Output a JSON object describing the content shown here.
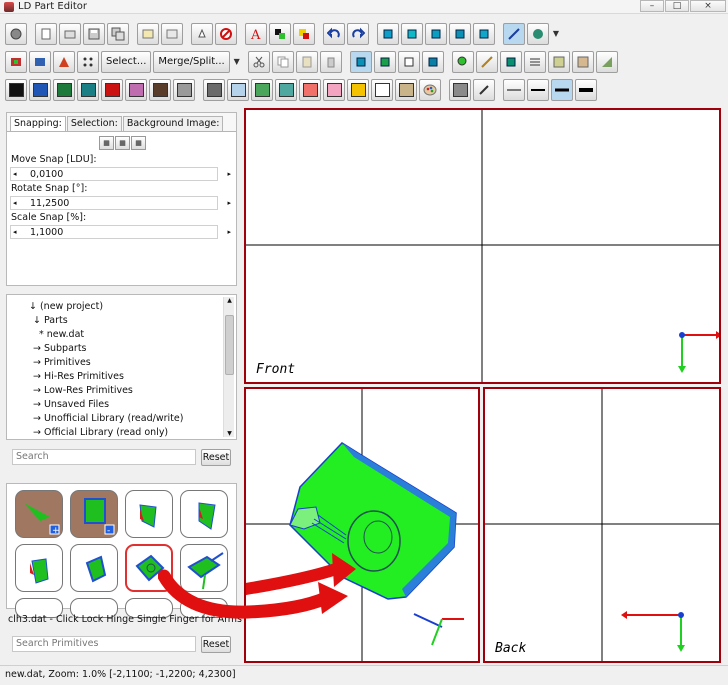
{
  "window": {
    "title": "LD Part Editor",
    "buttons": [
      "–",
      "□",
      "×"
    ]
  },
  "toolbar2": {
    "select_label": "Select...",
    "merge_label": "Merge/Split..."
  },
  "colors": {
    "swatches": [
      "#111111",
      "#1f55b5",
      "#1e7a3a",
      "#1a7f85",
      "#cc1111",
      "#c06db0",
      "#5a3c2a",
      "#9a9a9a",
      "#6a6a6a",
      "#b4d2ea",
      "#49a65a",
      "#4fa8a0",
      "#f0706a",
      "#f2a4c0",
      "#f5c200",
      "#ffffff",
      "#c9b48a"
    ],
    "accent_frame": "#a0000a",
    "model_green": "#20ee20",
    "arrow_red": "#e01010"
  },
  "snapping": {
    "tabs": [
      "Snapping:",
      "Selection:",
      "Background Image:"
    ],
    "move_label": "Move Snap [LDU]:",
    "move_value": "0,0100",
    "rotate_label": "Rotate Snap [°]:",
    "rotate_value": "11,2500",
    "scale_label": "Scale Snap [%]:",
    "scale_value": "1,1000"
  },
  "tree": {
    "items": [
      "↓ (new project)",
      "↓ Parts",
      "* new.dat",
      "→ Subparts",
      "→ Primitives",
      "→ Hi-Res Primitives",
      "→ Low-Res Primitives",
      "→ Unsaved Files",
      "→ Unofficial Library (read/write)",
      "→ Official Library (read only)"
    ]
  },
  "search": {
    "placeholder": "Search",
    "reset_label": "Reset"
  },
  "primitives": {
    "selected_description": "clh3.dat - Click Lock Hinge Single Finger for Arms",
    "search_placeholder": "Search Primitives",
    "reset_label": "Reset"
  },
  "viewports": {
    "front_label": "Front",
    "back_label": "Back"
  },
  "status": {
    "text": "new.dat, Zoom: 1.0% [-2,1100; -1,2200; 4,2300]"
  }
}
